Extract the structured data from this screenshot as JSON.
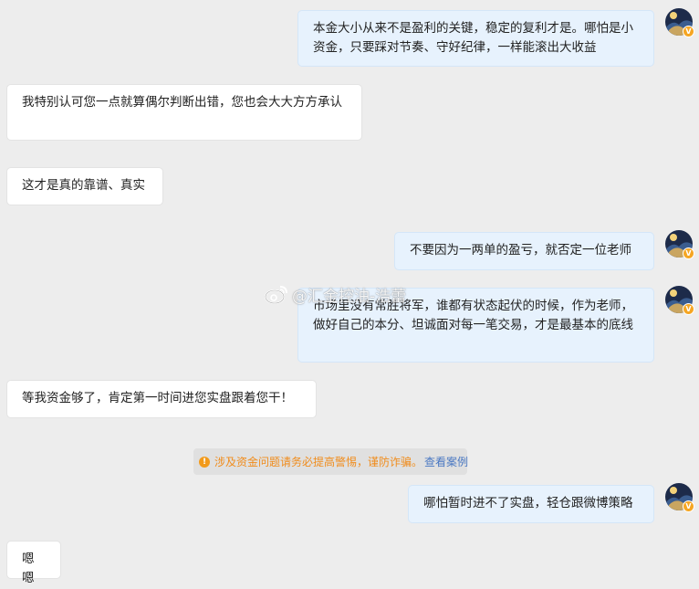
{
  "chat": {
    "messages": [
      {
        "side": "out",
        "text": "本金大小从来不是盈利的关键，稳定的复利才是。哪怕是小资金，只要踩对节奏、守好纪律，一样能滚出大收益"
      },
      {
        "side": "in",
        "text": "我特别认可您一点就算偶尔判断出错，您也会大大方方承认"
      },
      {
        "side": "in",
        "text": "这才是真的靠谱、真实"
      },
      {
        "side": "out",
        "text": "不要因为一两单的盈亏，就否定一位老师"
      },
      {
        "side": "out",
        "text": "市场里没有常胜将军，谁都有状态起伏的时候，作为老师，做好自己的本分、坦诚面对每一笔交易，才是最基本的底线"
      },
      {
        "side": "in",
        "text": "等我资金够了，肯定第一时间进您实盘跟着您干！"
      },
      {
        "side": "out",
        "text": "哪怕暂时进不了实盘，轻仓跟微博策略"
      },
      {
        "side": "in",
        "text": "嗯嗯"
      }
    ]
  },
  "notice": {
    "icon": "warning-icon",
    "text": "涉及资金问题请务必提高警惕，谨防诈骗。",
    "link": "查看案例",
    "text_color": "#f08c1c",
    "link_color": "#4a78c2"
  },
  "watermark": {
    "text": "@汇金控油-浩蕾",
    "logo": "weibo-logo"
  },
  "avatar": {
    "badge": "V",
    "badge_color": "#f5a623"
  },
  "colors": {
    "background": "#ededed",
    "outgoing_bubble": "#e7f2fd",
    "incoming_bubble": "#ffffff"
  }
}
